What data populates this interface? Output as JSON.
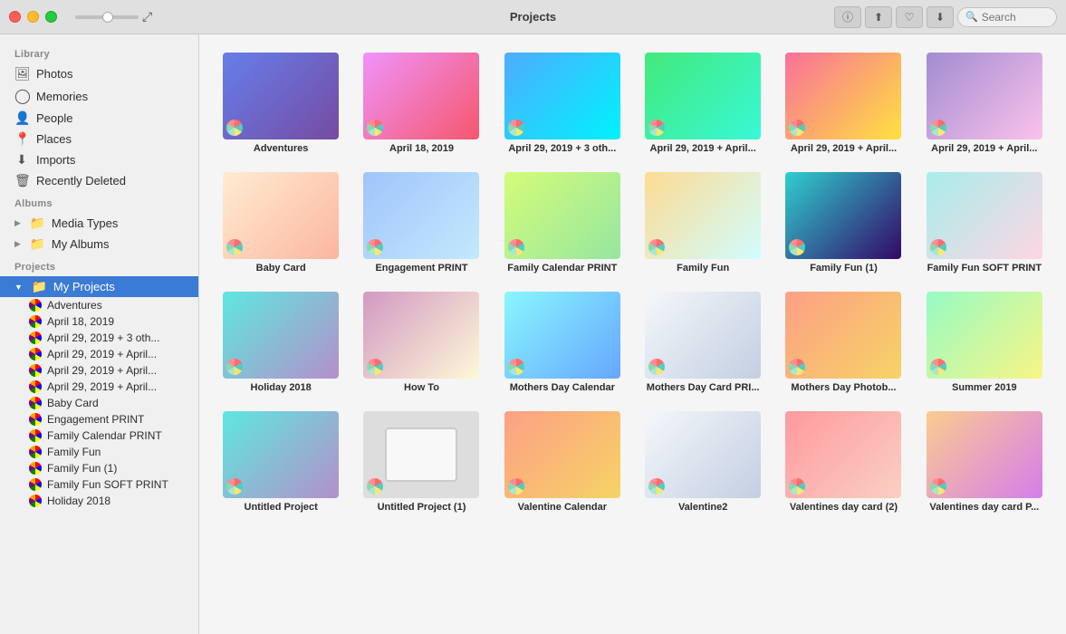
{
  "titlebar": {
    "title": "Projects",
    "search_placeholder": "Search"
  },
  "sidebar": {
    "library_title": "Library",
    "library_items": [
      {
        "id": "photos",
        "label": "Photos",
        "icon": "🖼"
      },
      {
        "id": "memories",
        "label": "Memories",
        "icon": "⊙"
      },
      {
        "id": "people",
        "label": "People",
        "icon": "👤"
      },
      {
        "id": "places",
        "label": "Places",
        "icon": "📍"
      },
      {
        "id": "imports",
        "label": "Imports",
        "icon": "↓"
      },
      {
        "id": "recently-deleted",
        "label": "Recently Deleted",
        "icon": "🗑"
      }
    ],
    "albums_title": "Albums",
    "albums_items": [
      {
        "id": "media-types",
        "label": "Media Types",
        "expandable": true
      },
      {
        "id": "my-albums",
        "label": "My Albums",
        "expandable": true
      }
    ],
    "projects_title": "Projects",
    "projects_root": "My Projects",
    "projects_items": [
      {
        "id": "adventures",
        "label": "Adventures"
      },
      {
        "id": "april-18",
        "label": "April 18, 2019"
      },
      {
        "id": "april-29-1",
        "label": "April 29, 2019 + 3 oth..."
      },
      {
        "id": "april-29-2",
        "label": "April 29, 2019 + April..."
      },
      {
        "id": "april-29-3",
        "label": "April 29, 2019 + April..."
      },
      {
        "id": "april-29-4",
        "label": "April 29, 2019 + April..."
      },
      {
        "id": "baby-card",
        "label": "Baby Card"
      },
      {
        "id": "engagement-print",
        "label": "Engagement PRINT"
      },
      {
        "id": "family-calendar-print",
        "label": "Family Calendar PRINT"
      },
      {
        "id": "family-fun",
        "label": "Family Fun"
      },
      {
        "id": "family-fun-1",
        "label": "Family Fun (1)"
      },
      {
        "id": "family-fun-soft",
        "label": "Family Fun SOFT PRINT"
      },
      {
        "id": "holiday-2018",
        "label": "Holiday 2018"
      }
    ]
  },
  "projects": {
    "items": [
      {
        "id": "adventures",
        "name": "Adventures",
        "thumb_class": "thumb-1"
      },
      {
        "id": "april-18",
        "name": "April 18, 2019",
        "thumb_class": "thumb-2"
      },
      {
        "id": "april-29-3oth",
        "name": "April 29, 2019 + 3 oth...",
        "thumb_class": "thumb-3"
      },
      {
        "id": "april-29-april1",
        "name": "April 29, 2019 + April...",
        "thumb_class": "thumb-4"
      },
      {
        "id": "april-29-april2",
        "name": "April 29, 2019 + April...",
        "thumb_class": "thumb-5"
      },
      {
        "id": "april-29-april3",
        "name": "April 29, 2019 + April...",
        "thumb_class": "thumb-6"
      },
      {
        "id": "baby-card",
        "name": "Baby Card",
        "thumb_class": "thumb-7"
      },
      {
        "id": "engagement-print",
        "name": "Engagement PRINT",
        "thumb_class": "thumb-8"
      },
      {
        "id": "family-calendar-print",
        "name": "Family Calendar PRINT",
        "thumb_class": "thumb-9"
      },
      {
        "id": "family-fun",
        "name": "Family Fun",
        "thumb_class": "thumb-10"
      },
      {
        "id": "family-fun-1",
        "name": "Family Fun (1)",
        "thumb_class": "thumb-11"
      },
      {
        "id": "family-fun-soft",
        "name": "Family Fun SOFT PRINT",
        "thumb_class": "thumb-12"
      },
      {
        "id": "holiday-2018",
        "name": "Holiday 2018",
        "thumb_class": "thumb-13"
      },
      {
        "id": "how-to",
        "name": "How To",
        "thumb_class": "thumb-14"
      },
      {
        "id": "mothers-day-cal",
        "name": "Mothers Day Calendar",
        "thumb_class": "thumb-15"
      },
      {
        "id": "mothers-day-card",
        "name": "Mothers Day Card PRI...",
        "thumb_class": "thumb-19"
      },
      {
        "id": "mothers-day-photo",
        "name": "Mothers Day Photob...",
        "thumb_class": "thumb-17"
      },
      {
        "id": "summer-2019",
        "name": "Summer 2019",
        "thumb_class": "thumb-18"
      },
      {
        "id": "untitled",
        "name": "Untitled Project",
        "thumb_class": "thumb-13"
      },
      {
        "id": "untitled-1",
        "name": "Untitled Project (1)",
        "thumb_class": "thumb-16",
        "blank": true
      },
      {
        "id": "valentine-cal",
        "name": "Valentine Calendar",
        "thumb_class": "thumb-17"
      },
      {
        "id": "valentine2",
        "name": "Valentine2",
        "thumb_class": "thumb-19"
      },
      {
        "id": "valentines-day-card-2",
        "name": "Valentines day card (2)",
        "thumb_class": "thumb-20"
      },
      {
        "id": "valentines-day-card-p",
        "name": "Valentines day card P...",
        "thumb_class": "thumb-21"
      }
    ]
  }
}
